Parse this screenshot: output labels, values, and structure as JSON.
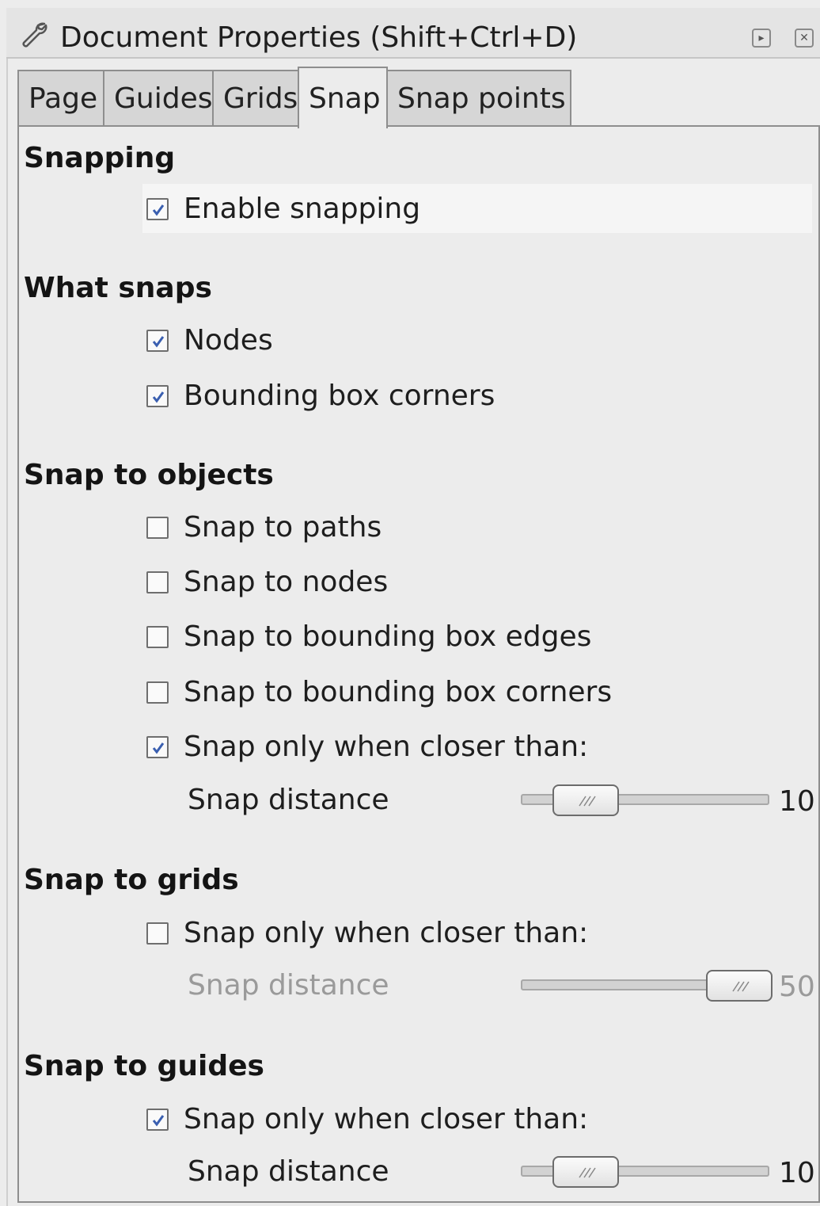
{
  "window": {
    "title": "Document Properties (Shift+Ctrl+D)",
    "icon": "wrench-icon",
    "buttons": [
      "detach-icon",
      "close-icon"
    ]
  },
  "tabs": [
    {
      "label": "Page",
      "active": false
    },
    {
      "label": "Guides",
      "active": false
    },
    {
      "label": "Grids",
      "active": false
    },
    {
      "label": "Snap",
      "active": true
    },
    {
      "label": "Snap points",
      "active": false
    }
  ],
  "sections": {
    "snapping": {
      "title": "Snapping",
      "enable_snapping": {
        "label": "Enable snapping",
        "checked": true
      }
    },
    "what_snaps": {
      "title": "What snaps",
      "nodes": {
        "label": "Nodes",
        "checked": true
      },
      "bbox_corners": {
        "label": "Bounding box corners",
        "checked": true
      }
    },
    "snap_to_objects": {
      "title": "Snap to objects",
      "paths": {
        "label": "Snap to paths",
        "checked": false
      },
      "nodes": {
        "label": "Snap to nodes",
        "checked": false
      },
      "bbox_edges": {
        "label": "Snap to bounding box edges",
        "checked": false
      },
      "bbox_corners": {
        "label": "Snap to bounding box corners",
        "checked": false
      },
      "closer": {
        "label": "Snap only when closer than:",
        "checked": true
      },
      "distance": {
        "label": "Snap distance",
        "value": "10",
        "fraction": 0.0
      }
    },
    "snap_to_grids": {
      "title": "Snap to grids",
      "closer": {
        "label": "Snap only when closer than:",
        "checked": false
      },
      "distance": {
        "label": "Snap distance",
        "value": "50",
        "fraction": 1.0,
        "disabled": true
      }
    },
    "snap_to_guides": {
      "title": "Snap to guides",
      "closer": {
        "label": "Snap only when closer than:",
        "checked": true
      },
      "distance": {
        "label": "Snap distance",
        "value": "10",
        "fraction": 0.0
      }
    }
  },
  "colors": {
    "check": "#3a5fb0",
    "window_bg": "#ececec"
  }
}
